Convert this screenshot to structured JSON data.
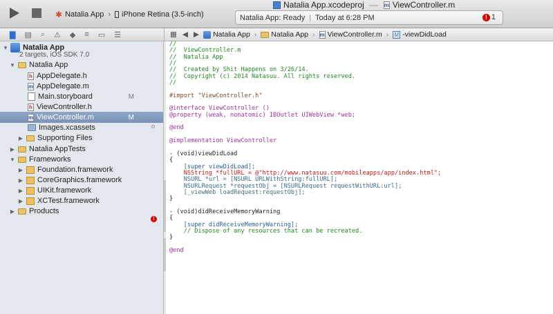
{
  "window": {
    "project_file": "Natalia App.xcodeproj",
    "current_file": "ViewController.m"
  },
  "toolbar": {
    "scheme": "Natalia App",
    "destination": "iPhone Retina (3.5-inch)",
    "status": {
      "app": "Natalia App:",
      "state": "Ready",
      "time": "Today at 6:28 PM",
      "error_count": "1"
    }
  },
  "jump_bar": {
    "crumbs": [
      "Natalia App",
      "Natalia App",
      "ViewController.m",
      "-viewDidLoad"
    ]
  },
  "navigator": {
    "project": {
      "name": "Natalia App",
      "subtitle": "2 targets, iOS SDK 7.0"
    },
    "items": [
      {
        "label": "Natalia App",
        "badge": ""
      },
      {
        "label": "AppDelegate.h",
        "badge": ""
      },
      {
        "label": "AppDelegate.m",
        "badge": ""
      },
      {
        "label": "Main.storyboard",
        "badge": "M"
      },
      {
        "label": "ViewController.h",
        "badge": ""
      },
      {
        "label": "ViewController.m",
        "badge": "M"
      },
      {
        "label": "Images.xcassets",
        "badge": ""
      },
      {
        "label": "Supporting Files",
        "badge": ""
      },
      {
        "label": "Natalia AppTests",
        "badge": ""
      },
      {
        "label": "Frameworks",
        "badge": ""
      },
      {
        "label": "Foundation.framework",
        "badge": ""
      },
      {
        "label": "CoreGraphics.framework",
        "badge": ""
      },
      {
        "label": "UIKit.framework",
        "badge": ""
      },
      {
        "label": "XCTest.framework",
        "badge": ""
      },
      {
        "label": "Products",
        "badge": ""
      }
    ]
  },
  "editor": {
    "lines": [
      "//",
      "//  ViewController.m",
      "//  Natalia App",
      "//",
      "//  Created by Shit Happens on 3/26/14.",
      "//  Copyright (c) 2014 Natasuu. All rights reserved.",
      "//",
      "",
      "#import \"ViewController.h\"",
      "",
      "@interface ViewController ()",
      "@property (weak, nonatomic) IBOutlet UIWebView *web;",
      "",
      "@end",
      "",
      "@implementation ViewController",
      "",
      "- (void)viewDidLoad",
      "{",
      "    [super viewDidLoad];",
      "    NSString *fullURL = @\"http://www.natasuu.com/mobileapps/app/index.html\";",
      "    NSURL *url = [NSURL URLWithString:fullURL];",
      "    NSURLRequest *requestObj = [NSURLRequest requestWithURL:url];",
      "    [_viewWeb loadRequest:requestObj];",
      "}",
      "",
      "- (void)didReceiveMemoryWarning",
      "{",
      "    [super didReceiveMemoryWarning];",
      "    // Dispose of any resources that can be recreated.",
      "}",
      "",
      "@end"
    ]
  }
}
